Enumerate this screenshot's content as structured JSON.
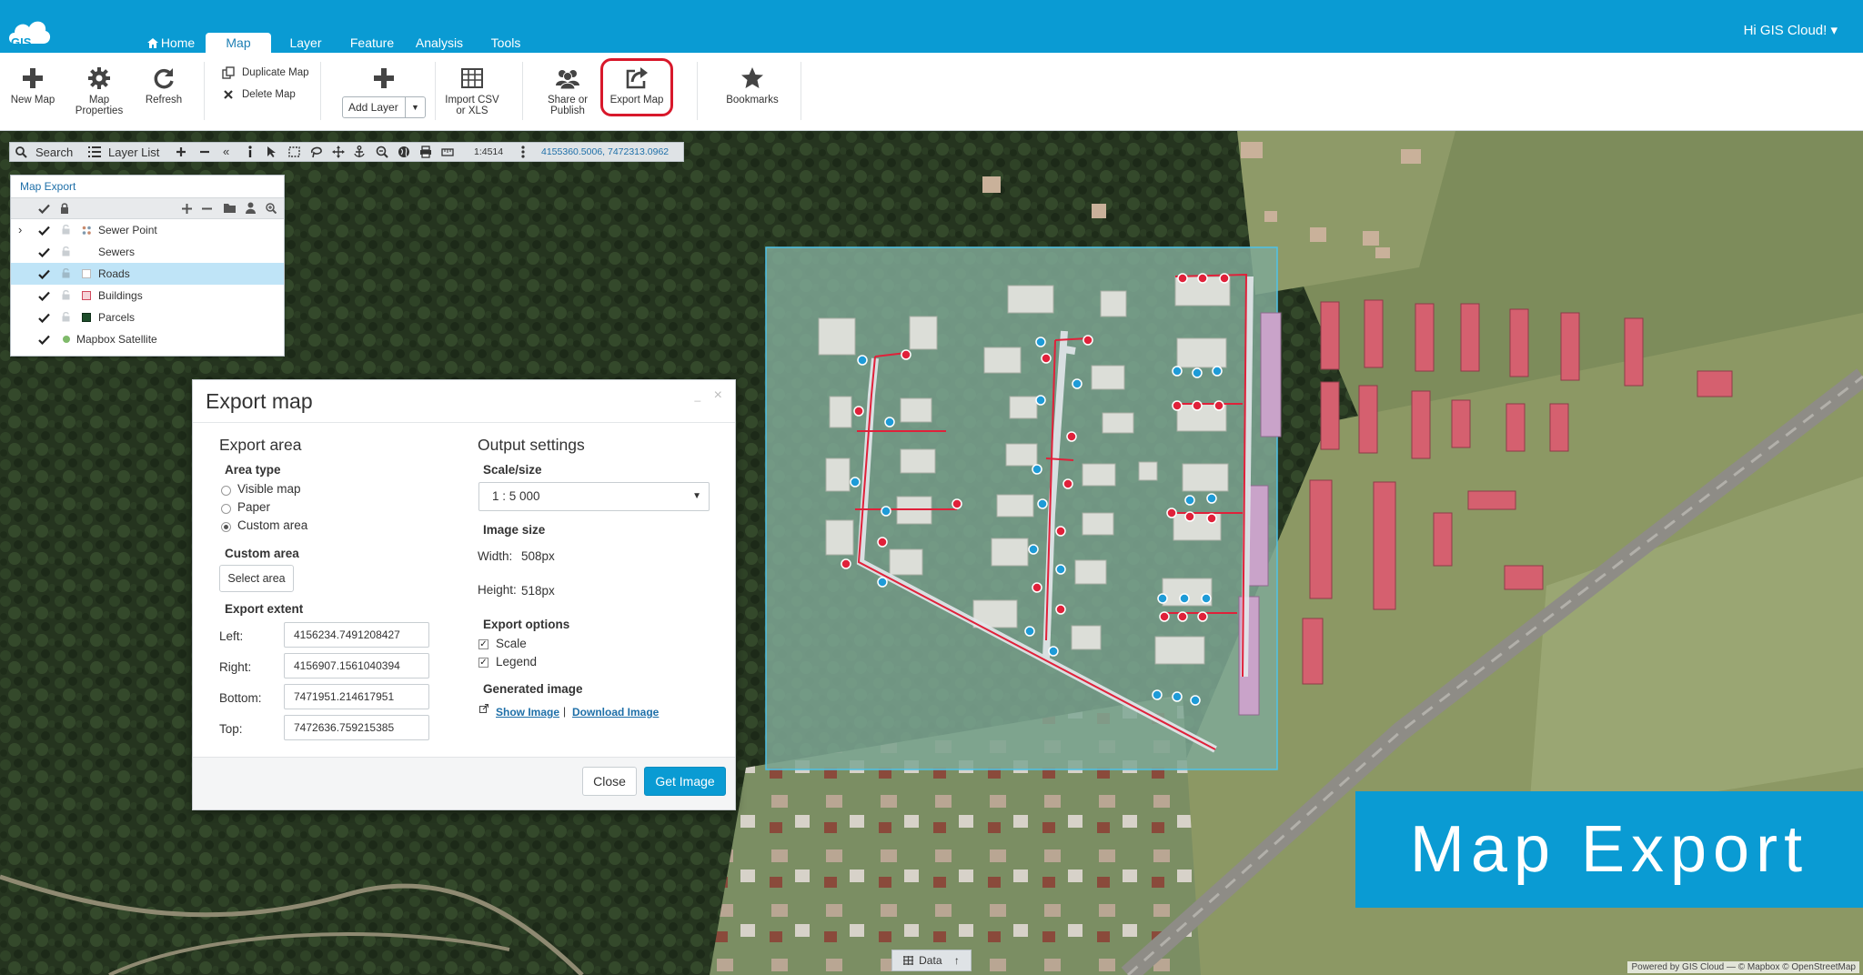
{
  "app": {
    "greeting": "Hi GIS Cloud! ▾",
    "logo_text": "GIS"
  },
  "nav": {
    "tabs": [
      {
        "label": "Home"
      },
      {
        "label": "Map"
      },
      {
        "label": "Layer"
      },
      {
        "label": "Feature"
      },
      {
        "label": "Analysis"
      },
      {
        "label": "Tools"
      }
    ],
    "active": "Map"
  },
  "ribbon": {
    "new_map": "New Map",
    "map_properties_1": "Map",
    "map_properties_2": "Properties",
    "refresh": "Refresh",
    "duplicate_map": "Duplicate Map",
    "delete_map": "Delete Map",
    "add_layer": "Add Layer",
    "import_csv_1": "Import CSV",
    "import_csv_2": "or XLS",
    "share_1": "Share or",
    "share_2": "Publish",
    "export_map": "Export Map",
    "bookmarks": "Bookmarks"
  },
  "map_toolbar": {
    "search": "Search",
    "layer_list": "Layer List",
    "scale": "1:4514",
    "coords": "4155360.5006, 7472313.0962"
  },
  "layer_panel": {
    "title": "Map Export",
    "layers": [
      {
        "name": "Sewer Point",
        "expandable": true
      },
      {
        "name": "Sewers"
      },
      {
        "name": "Roads",
        "selected": true
      },
      {
        "name": "Buildings"
      },
      {
        "name": "Parcels"
      },
      {
        "name": "Mapbox Satellite"
      }
    ]
  },
  "export_dialog": {
    "title": "Export map",
    "export_area": "Export area",
    "area_type": "Area type",
    "options": [
      "Visible map",
      "Paper",
      "Custom area"
    ],
    "selected_option": "Custom area",
    "custom_area": "Custom area",
    "select_area": "Select area",
    "export_extent": "Export extent",
    "left_label": "Left:",
    "left_value": "4156234.7491208427",
    "right_label": "Right:",
    "right_value": "4156907.1561040394",
    "bottom_label": "Bottom:",
    "bottom_value": "7471951.214617951",
    "top_label": "Top:",
    "top_value": "7472636.759215385",
    "output_settings": "Output settings",
    "scale_size": "Scale/size",
    "scale_value": "1 : 5 000",
    "image_size": "Image size",
    "width_label": "Width:",
    "width_value": "508px",
    "height_label": "Height:",
    "height_value": "518px",
    "export_options": "Export options",
    "scale_check": "Scale",
    "legend_check": "Legend",
    "generated_image": "Generated image",
    "show_image": "Show Image",
    "separator": "|",
    "download_image": "Download Image",
    "close": "Close",
    "get_image": "Get Image"
  },
  "overlay": {
    "banner": "Map Export",
    "data_tab": "Data",
    "attribution": "Powered by GIS Cloud — © Mapbox © OpenStreetMap"
  },
  "colors": {
    "brand": "#0a9bd3",
    "highlight": "#d8182b",
    "sewer_red": "#e0213a",
    "sewer_blue": "#1e9bd7"
  }
}
